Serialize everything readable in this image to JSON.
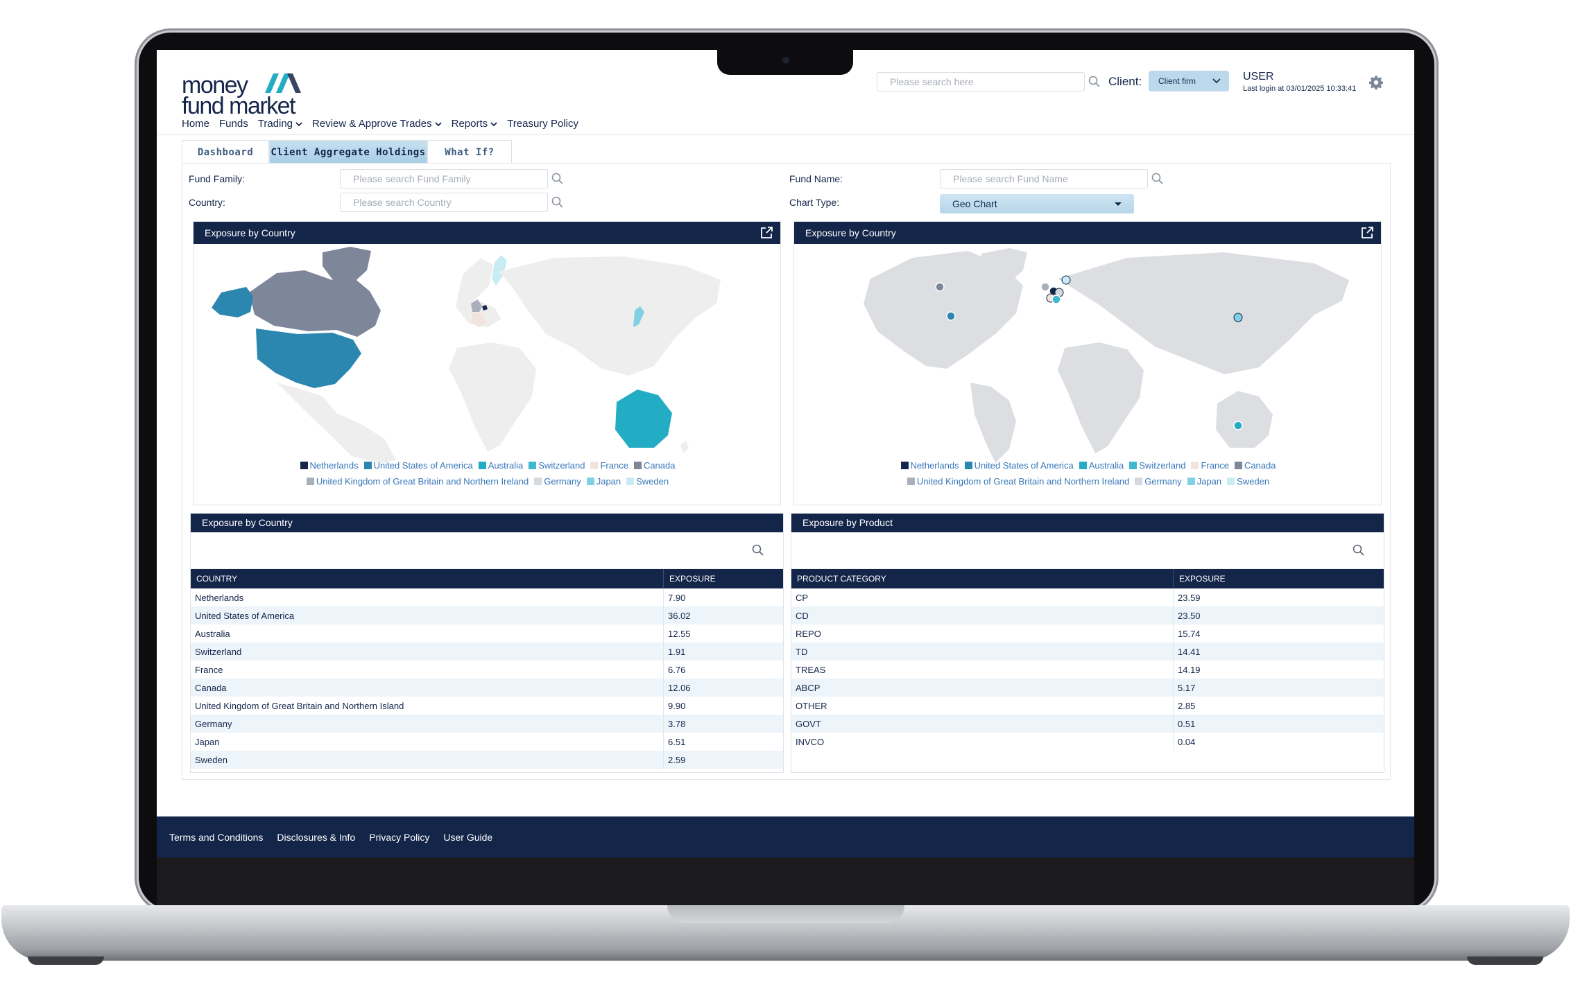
{
  "brand": {
    "line1": "money",
    "line2": "fund market"
  },
  "header": {
    "search_placeholder": "Please search here",
    "client_label": "Client:",
    "client_value": "Client firm",
    "user_name": "USER",
    "last_login": "Last login at 03/01/2025 10:33:41"
  },
  "nav": {
    "home": "Home",
    "funds": "Funds",
    "trading": "Trading",
    "review": "Review & Approve Trades",
    "reports": "Reports",
    "treasury": "Treasury Policy"
  },
  "tabs": {
    "dashboard": "Dashboard",
    "holdings": "Client Aggregate Holdings",
    "whatif": "What If?"
  },
  "filters": {
    "fund_family_label": "Fund Family:",
    "fund_family_placeholder": "Please search Fund Family",
    "country_label": "Country:",
    "country_placeholder": "Please search Country",
    "fund_name_label": "Fund Name:",
    "fund_name_placeholder": "Please search Fund Name",
    "chart_type_label": "Chart Type:",
    "chart_type_value": "Geo Chart"
  },
  "colors": {
    "navy": "#14254a",
    "netherlands": "#14254a",
    "usa": "#2b86b0",
    "australia": "#23adc4",
    "switzerland": "#3fb8d0",
    "france": "#f1e4dc",
    "canada": "#7d8799",
    "uk": "#a9b0bb",
    "germany": "#d5d9de",
    "japan": "#7fd1e3",
    "sweden": "#c8ecf4"
  },
  "map_left": {
    "title": "Exposure by Country"
  },
  "map_right": {
    "title": "Exposure by Country"
  },
  "legend": {
    "netherlands": "Netherlands",
    "usa": "United States of America",
    "australia": "Australia",
    "switzerland": "Switzerland",
    "france": "France",
    "canada": "Canada",
    "uk": "United Kingdom of Great Britain and Northern Ireland",
    "germany": "Germany",
    "japan": "Japan",
    "sweden": "Sweden"
  },
  "country_table": {
    "title": "Exposure by Country",
    "col1": "COUNTRY",
    "col2": "EXPOSURE",
    "rows": [
      {
        "name": "Netherlands",
        "value": "7.90"
      },
      {
        "name": "United States of America",
        "value": "36.02"
      },
      {
        "name": "Australia",
        "value": "12.55"
      },
      {
        "name": "Switzerland",
        "value": "1.91"
      },
      {
        "name": "France",
        "value": "6.76"
      },
      {
        "name": "Canada",
        "value": "12.06"
      },
      {
        "name": "United Kingdom of Great Britain and Northern Island",
        "value": "9.90"
      },
      {
        "name": "Germany",
        "value": "3.78"
      },
      {
        "name": "Japan",
        "value": "6.51"
      },
      {
        "name": "Sweden",
        "value": "2.59"
      }
    ]
  },
  "product_table": {
    "title": "Exposure by Product",
    "col1": "PRODUCT CATEGORY",
    "col2": "EXPOSURE",
    "rows": [
      {
        "name": "CP",
        "value": "23.59"
      },
      {
        "name": "CD",
        "value": "23.50"
      },
      {
        "name": "REPO",
        "value": "15.74"
      },
      {
        "name": "TD",
        "value": "14.41"
      },
      {
        "name": "TREAS",
        "value": "14.19"
      },
      {
        "name": "ABCP",
        "value": "5.17"
      },
      {
        "name": "OTHER",
        "value": "2.85"
      },
      {
        "name": "GOVT",
        "value": "0.51"
      },
      {
        "name": "INVCO",
        "value": "0.04"
      }
    ]
  },
  "footer": {
    "terms": "Terms and Conditions",
    "disclosures": "Disclosures & Info",
    "privacy": "Privacy Policy",
    "guide": "User Guide"
  }
}
